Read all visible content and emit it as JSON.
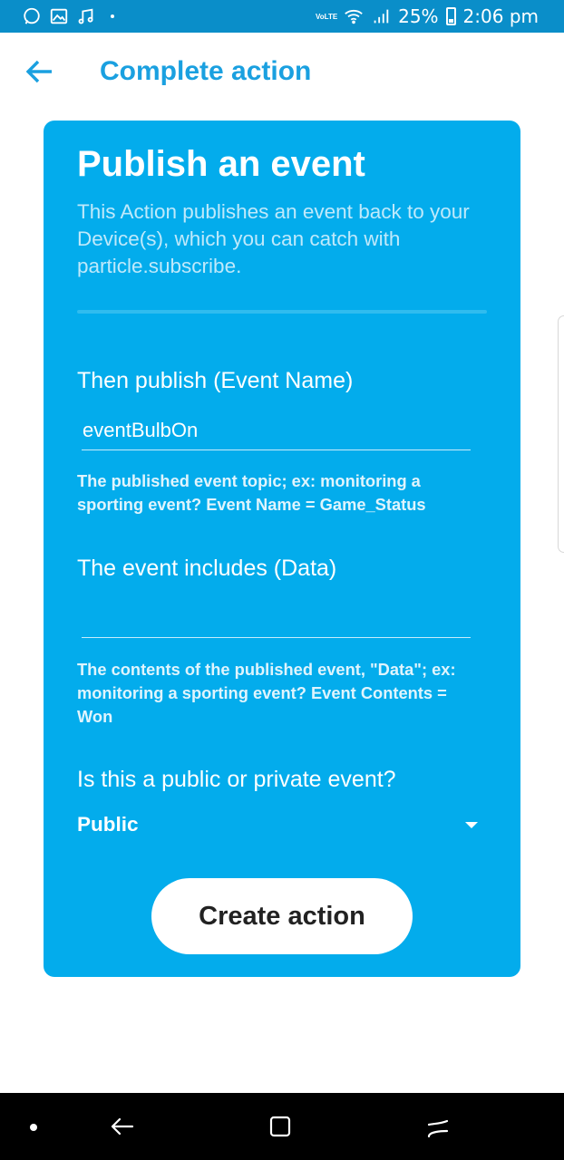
{
  "status_bar": {
    "icons": [
      "whatsapp-icon",
      "gallery-icon",
      "music-icon",
      "volte-icon",
      "wifi-icon",
      "signal-icon",
      "battery-icon"
    ],
    "network": "VoLTE",
    "battery": "25%",
    "time": "2:06 pm"
  },
  "header": {
    "title": "Complete action",
    "back_icon": "arrow-left-icon"
  },
  "card": {
    "title": "Publish an event",
    "description": "This Action publishes an event back to your Device(s), which you can catch with particle.subscribe.",
    "fields": [
      {
        "label": "Then publish (Event Name)",
        "value": "eventBulbOn",
        "help": "The published event topic; ex: monitoring a sporting event? Event Name = Game_Status"
      },
      {
        "label": "The event includes (Data)",
        "value": "",
        "help": "The contents of the published event, \"Data\"; ex: monitoring a sporting event? Event Contents = Won"
      }
    ],
    "visibility": {
      "label": "Is this a public or private event?",
      "selected": "Public"
    },
    "submit_label": "Create action"
  },
  "colors": {
    "accent": "#1aa0e0",
    "card_bg": "#03acec",
    "status_bar": "#0a8ec9"
  },
  "nav_bar": {
    "icons": [
      "dot-icon",
      "back-nav-icon",
      "home-nav-icon",
      "recents-nav-icon"
    ]
  }
}
